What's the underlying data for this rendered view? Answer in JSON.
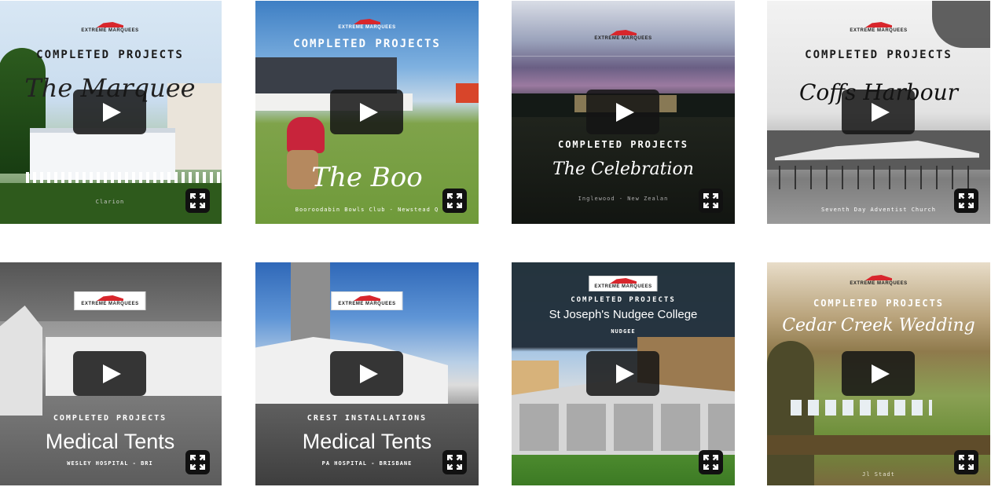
{
  "brand": {
    "logo_text": "EXTREME MARQUEES",
    "accent": "#d8262c"
  },
  "tiles": [
    {
      "heading": "COMPLETED PROJECTS",
      "title": "The Marquee",
      "location": "Clarion",
      "play_icon": "play-icon",
      "expand_icon": "expand-icon"
    },
    {
      "heading": "COMPLETED PROJECTS",
      "title": "The Boo",
      "location": "Booroodabin Bowls Club - Newstead Q"
    },
    {
      "heading": "COMPLETED PROJECTS",
      "title": "The Celebration",
      "location": "Inglewood - New Zealan"
    },
    {
      "heading": "COMPLETED PROJECTS",
      "title": "Coffs Harbour",
      "location": "Seventh Day Adventist Church"
    },
    {
      "heading": "COMPLETED PROJECTS",
      "title": "Medical Tents",
      "location": "WESLEY HOSPITAL - BRI"
    },
    {
      "heading": "CREST INSTALLATIONS",
      "title": "Medical Tents",
      "location": "PA HOSPITAL - BRISBANE"
    },
    {
      "heading": "COMPLETED PROJECTS",
      "title": "St Joseph's Nudgee College",
      "location": "NUDGEE"
    },
    {
      "heading": "COMPLETED PROJECTS",
      "title": "Cedar Creek Wedding",
      "location": "Jl Stadt"
    }
  ]
}
